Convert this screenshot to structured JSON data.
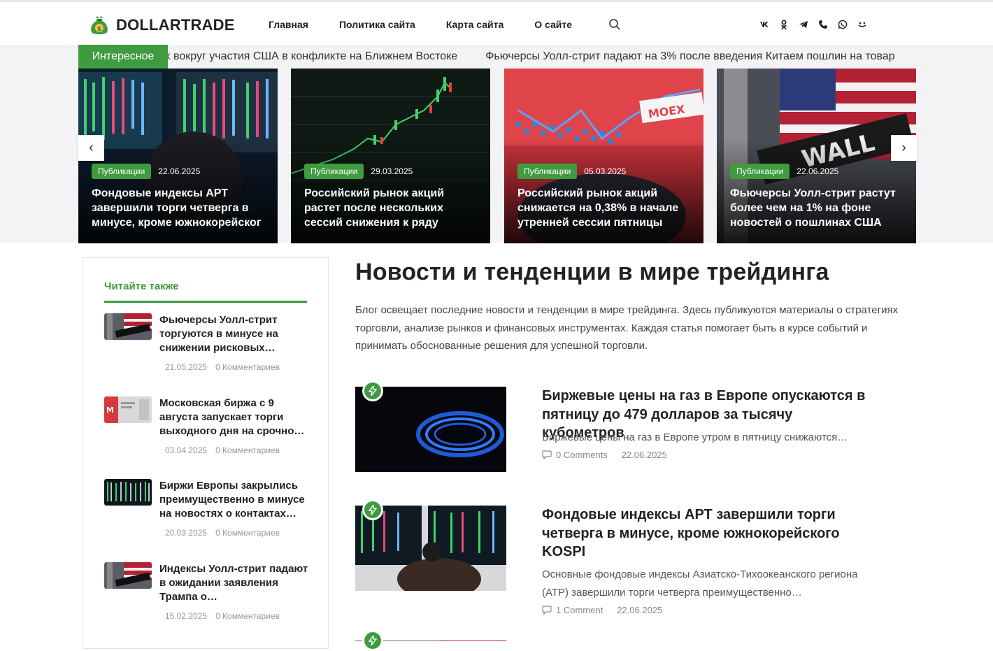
{
  "header": {
    "logo_text": "DOLLARTRADE",
    "nav": [
      "Главная",
      "Политика сайта",
      "Карта сайта",
      "О сайте"
    ],
    "socials": [
      "vk-icon",
      "odnoklassniki-icon",
      "telegram-icon",
      "viber-icon",
      "whatsapp-icon",
      "moimir-icon"
    ]
  },
  "ticker": {
    "label": "Интересное",
    "items": [
      "иях вокруг участия США в конфликте на Ближнем Востоке",
      "Фьючерсы Уолл-стрит падают на 3% после введения Китаем пошлин на товар"
    ]
  },
  "slider": {
    "prev": "‹",
    "next": "›",
    "cards": [
      {
        "badge": "Публикации",
        "date": "22.06.2025",
        "title": "Фондовые индексы АРТ завершили торги четверга в минусе, кроме южнокорейског"
      },
      {
        "badge": "Публикации",
        "date": "29.03.2025",
        "title": "Российский рынок акций растет после нескольких сессий снижения к ряду"
      },
      {
        "badge": "Публикации",
        "date": "05.03.2025",
        "title": "Российский рынок акций снижается на 0,38% в начале утренней сессии пятницы"
      },
      {
        "badge": "Публикации",
        "date": "22.06.2025",
        "title": "Фьючерсы Уолл-стрит растут более чем на 1% на фоне новостей о пошлинах США"
      }
    ]
  },
  "sidebar": {
    "heading": "Читайте также",
    "items": [
      {
        "title": "Фьючерсы Уолл-стрит торгуются в минусе на снижении рисковых…",
        "date": "21.05.2025",
        "comments": "0 Комментариев"
      },
      {
        "title": "Московская биржа с 9 августа запускает торги выходного дня на срочно…",
        "date": "03.04.2025",
        "comments": "0 Комментариев"
      },
      {
        "title": "Биржи Европы закрылись преимущественно в минусе на новостях о контактах…",
        "date": "20.03.2025",
        "comments": "0 Комментариев"
      },
      {
        "title": "Индексы Уолл-стрит падают в ожидании заявления Трампа о…",
        "date": "15.02.2025",
        "comments": "0 Комментариев"
      }
    ]
  },
  "main": {
    "title": "Новости и тенденции в мире трейдинга",
    "intro": "Блог освещает последние новости и тенденции в мире трейдинга. Здесь публикуются материалы о стратегиях торговли, анализе рынков и финансовых инструментах. Каждая статья помогает быть в курсе событий и принимать обоснованные решения для успешной торговли.",
    "posts": [
      {
        "title": "Биржевые цены на газ в Европе опускаются в пятницу до 479 долларов за тысячу кубометров",
        "excerpt": "Биржевые цены на газ в Европе утром в пятницу снижаются…",
        "comments": "0 Comments",
        "date": "22.06.2025"
      },
      {
        "title": "Фондовые индексы АРТ завершили торги четверга в минусе, кроме южнокорейского KOSPI",
        "excerpt": "Основные фондовые индексы Азиатско-Тихоокеанского региона (АТР) завершили торги четверга преимущественно…",
        "comments": "1 Comment",
        "date": "22.06.2025"
      }
    ]
  },
  "colors": {
    "accent": "#3f9b3f",
    "text": "#222222",
    "muted": "#999999"
  }
}
